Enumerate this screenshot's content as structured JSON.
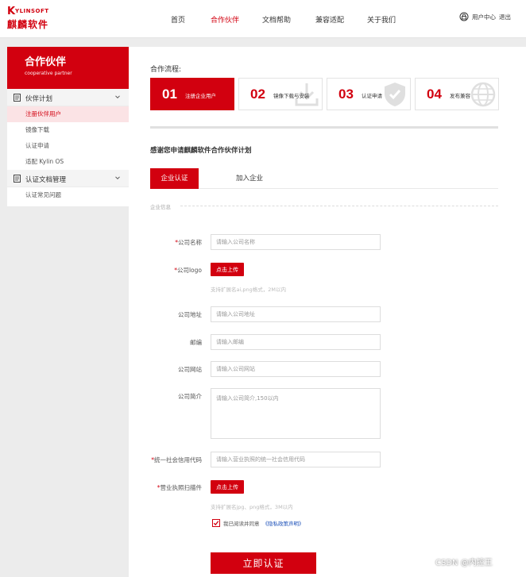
{
  "brand": {
    "mark": "K",
    "name_en": "YLINSOFT",
    "name_cn": "麒麟软件"
  },
  "nav": {
    "items": [
      {
        "label": "首页"
      },
      {
        "label": "合作伙伴",
        "active": true
      },
      {
        "label": "文档帮助"
      },
      {
        "label": "兼容适配"
      },
      {
        "label": "关于我们"
      }
    ]
  },
  "user": {
    "center_label": "用户中心",
    "logout_label": "退出"
  },
  "sidebar": {
    "title": "合作伙伴",
    "subtitle": "cooperative partner",
    "groups": [
      {
        "label": "伙伴计划",
        "items": [
          {
            "label": "注册伙伴用户",
            "active": true
          },
          {
            "label": "镜像下载"
          },
          {
            "label": "认证申请"
          },
          {
            "label": "适配 Kylin OS"
          }
        ]
      },
      {
        "label": "认证文档管理",
        "items": [
          {
            "label": "认证常见问题"
          }
        ]
      }
    ]
  },
  "main": {
    "flow_title": "合作流程:",
    "steps": [
      {
        "num": "01",
        "label": "注册企业用户",
        "active": true
      },
      {
        "num": "02",
        "label": "镜像下载与安装"
      },
      {
        "num": "03",
        "label": "认证申请"
      },
      {
        "num": "04",
        "label": "发布兼容"
      }
    ],
    "thanks": "感谢您申请麒麟软件合作伙伴计划",
    "tabs": [
      {
        "label": "企业认证",
        "active": true
      },
      {
        "label": "加入企业"
      }
    ],
    "section_label": "企业信息",
    "form": {
      "company_name": {
        "label": "公司名称",
        "required": true,
        "placeholder": "请输入公司名称"
      },
      "company_logo": {
        "label": "公司logo",
        "required": true,
        "button": "点击上传",
        "hint": "支持扩展名ai,png格式，2M以内"
      },
      "company_address": {
        "label": "公司地址",
        "placeholder": "请输入公司地址"
      },
      "email": {
        "label": "邮编",
        "placeholder": "请输入邮编"
      },
      "website": {
        "label": "公司网站",
        "placeholder": "请输入公司网站"
      },
      "intro": {
        "label": "公司简介",
        "placeholder": "请输入公司简介,150以内"
      },
      "credit_code": {
        "label": "统一社会信用代码",
        "required": true,
        "placeholder": "请输入营业执照的统一社会信用代码"
      },
      "license": {
        "label": "营业执照扫描件",
        "required": true,
        "button": "点击上传",
        "hint": "支持扩展名jpg、png格式，3M以内"
      },
      "agree_text": "我已阅读并同意",
      "policy_link": "《隐私政策声明》",
      "agree_checked": true,
      "submit": "立即认证"
    }
  },
  "watermark": "CSDN @内控王",
  "colors": {
    "brand_red": "#d2000f",
    "link_blue": "#1a4fb8"
  }
}
